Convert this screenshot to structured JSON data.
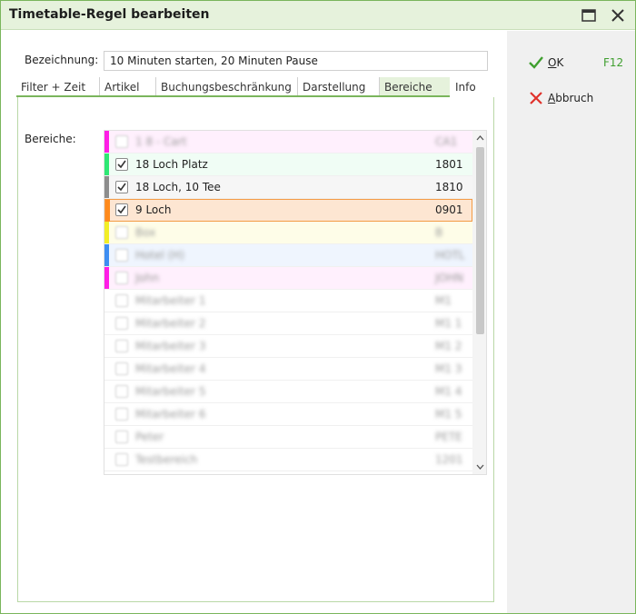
{
  "window": {
    "title": "Timetable-Regel bearbeiten"
  },
  "form": {
    "bezeichnung_label": "Bezeichnung:",
    "bezeichnung_value": "10 Minuten starten, 20 Minuten Pause"
  },
  "tabs": [
    {
      "label": "Filter + Zeit"
    },
    {
      "label": "Artikel"
    },
    {
      "label": "Buchungsbeschränkung"
    },
    {
      "label": "Darstellung"
    },
    {
      "label": "Bereiche",
      "active": true
    },
    {
      "label": "Info"
    }
  ],
  "bereiche": {
    "label": "Bereiche:",
    "items": [
      {
        "name": "1 8 - Cart",
        "code": "CA1",
        "checked": false,
        "color": "#ff1ee6",
        "bg": "#fff0fd",
        "blurred": true
      },
      {
        "name": "18 Loch Platz",
        "code": "1801",
        "checked": true,
        "color": "#2ee874",
        "bg": "#f0fdf5",
        "blurred": false
      },
      {
        "name": "18 Loch, 10 Tee",
        "code": "1810",
        "checked": true,
        "color": "#8d8d8d",
        "bg": "#f6f6f6",
        "blurred": false
      },
      {
        "name": "9 Loch",
        "code": "0901",
        "checked": true,
        "color": "#ff8a1c",
        "bg": "#fde6d2",
        "blurred": false,
        "selected": true
      },
      {
        "name": "Box",
        "code": "B",
        "checked": false,
        "color": "#f2ee26",
        "bg": "#fefde8",
        "blurred": true
      },
      {
        "name": "Hotel (H)",
        "code": "HOTL",
        "checked": false,
        "color": "#3e8ef2",
        "bg": "#eff5fe",
        "blurred": true
      },
      {
        "name": "John",
        "code": "JOHN",
        "checked": false,
        "color": "#ff1ee6",
        "bg": "#fff0fd",
        "blurred": true
      },
      {
        "name": "Mitarbeiter 1",
        "code": "M1",
        "checked": false,
        "color": "",
        "bg": "#ffffff",
        "blurred": true
      },
      {
        "name": "Mitarbeiter 2",
        "code": "M1 1",
        "checked": false,
        "color": "",
        "bg": "#ffffff",
        "blurred": true
      },
      {
        "name": "Mitarbeiter 3",
        "code": "M1 2",
        "checked": false,
        "color": "",
        "bg": "#ffffff",
        "blurred": true
      },
      {
        "name": "Mitarbeiter 4",
        "code": "M1 3",
        "checked": false,
        "color": "",
        "bg": "#ffffff",
        "blurred": true
      },
      {
        "name": "Mitarbeiter 5",
        "code": "M1 4",
        "checked": false,
        "color": "",
        "bg": "#ffffff",
        "blurred": true
      },
      {
        "name": "Mitarbeiter 6",
        "code": "M1 5",
        "checked": false,
        "color": "",
        "bg": "#ffffff",
        "blurred": true
      },
      {
        "name": "Peter",
        "code": "PETE",
        "checked": false,
        "color": "",
        "bg": "#ffffff",
        "blurred": true
      },
      {
        "name": "Testbereich",
        "code": "1201",
        "checked": false,
        "color": "",
        "bg": "#ffffff",
        "blurred": true
      }
    ]
  },
  "actions": {
    "ok_label": "OK",
    "ok_shortcut": "F12",
    "abbruch_label": "Abbruch"
  },
  "colors": {
    "accent_green": "#7ab55c",
    "ok_green": "#3f9f2f",
    "cancel_red": "#e0312b"
  },
  "icons": {
    "ok": "checkmark-icon",
    "cancel": "x-icon",
    "maximize": "maximize-icon",
    "close": "close-icon"
  }
}
